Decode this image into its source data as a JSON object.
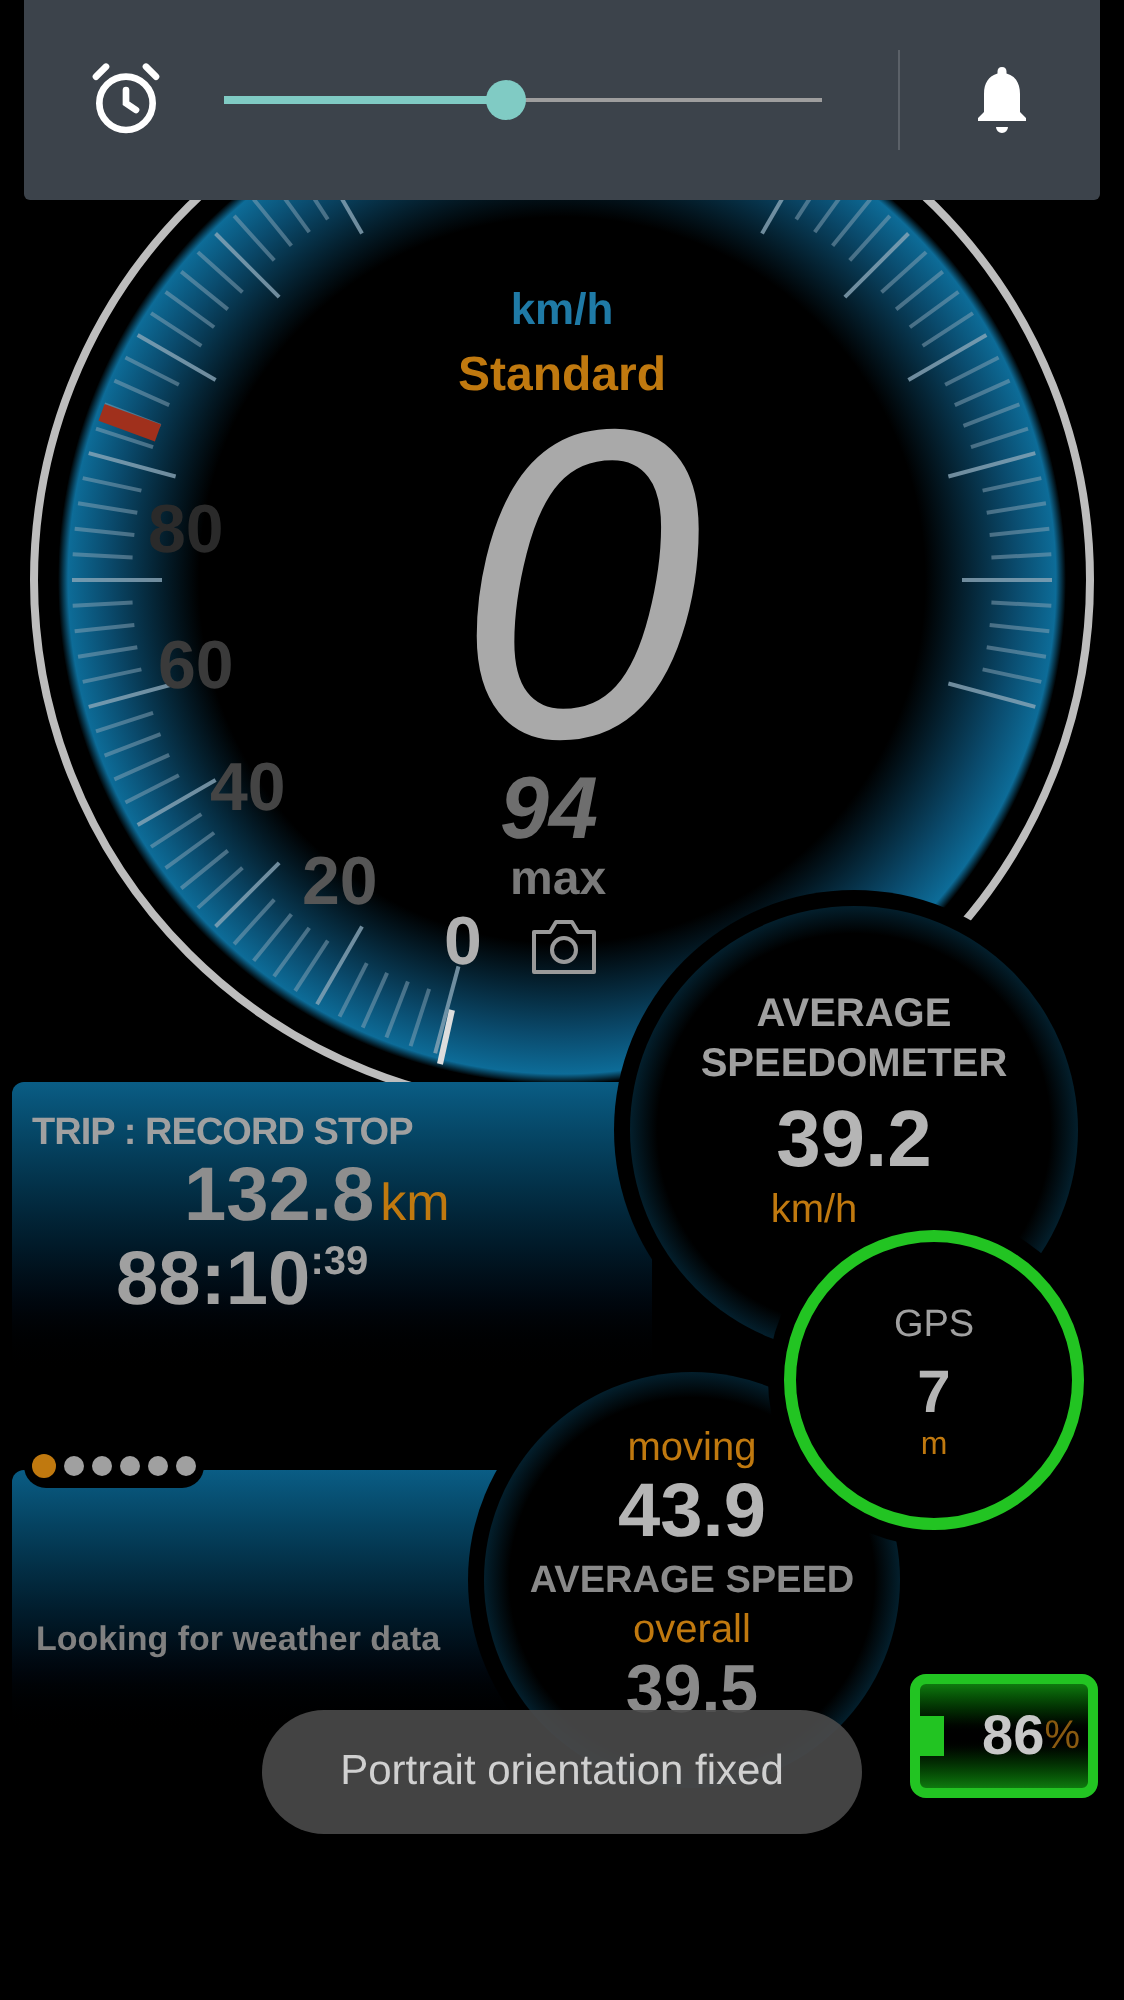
{
  "alarm_bar": {
    "slider": {
      "level": 0.47
    }
  },
  "speedometer": {
    "unit": "km/h",
    "mode": "Standard",
    "speed": "0",
    "scale": [
      "80",
      "60",
      "40",
      "20",
      "0"
    ],
    "max_value": "94",
    "max_label": "max"
  },
  "trip": {
    "title": "TRIP : RECORD STOP",
    "distance": "132.8",
    "distance_unit": "km",
    "time": "88:10",
    "time_seconds": ":39"
  },
  "average_speedometer": {
    "title_lines": [
      "AVERAGE",
      "SPEEDOMETER"
    ],
    "value": "39.2",
    "unit": "km/h"
  },
  "gps": {
    "label": "GPS",
    "value": "7",
    "unit": "m"
  },
  "pager": [
    {
      "selected": true
    },
    {
      "selected": false
    },
    {
      "selected": false
    },
    {
      "selected": false
    },
    {
      "selected": false
    },
    {
      "selected": false
    }
  ],
  "weather": {
    "status": "Looking for weather data"
  },
  "average_speed": {
    "moving_label": "moving",
    "moving_value": "43.9",
    "title": "AVERAGE SPEED",
    "overall_label": "overall",
    "overall_value": "39.5"
  },
  "battery": {
    "value": "86",
    "unit": "%"
  },
  "toast": "Portrait orientation fixed"
}
